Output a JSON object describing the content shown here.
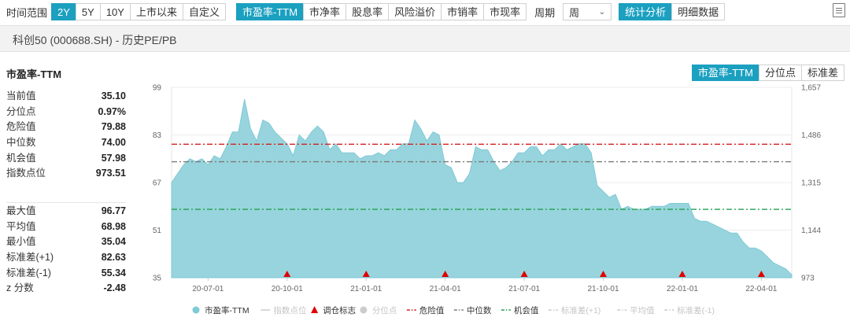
{
  "toolbar": {
    "time_label": "时间范围",
    "ranges": [
      {
        "label": "2Y",
        "active": true
      },
      {
        "label": "5Y",
        "active": false
      },
      {
        "label": "10Y",
        "active": false
      },
      {
        "label": "上市以来",
        "active": false
      },
      {
        "label": "自定义",
        "active": false
      }
    ],
    "metrics": [
      {
        "label": "市盈率-TTM",
        "active": true
      },
      {
        "label": "市净率",
        "active": false
      },
      {
        "label": "股息率",
        "active": false
      },
      {
        "label": "风险溢价",
        "active": false
      },
      {
        "label": "市销率",
        "active": false
      },
      {
        "label": "市现率",
        "active": false
      }
    ],
    "period_label": "周期",
    "period_value": "周",
    "views": [
      {
        "label": "统计分析",
        "active": true
      },
      {
        "label": "明细数据",
        "active": false
      }
    ]
  },
  "page_title": "科创50 (000688.SH) - 历史PE/PB",
  "panel_title": "市盈率-TTM",
  "stats_top": [
    {
      "label": "当前值",
      "value": "35.10"
    },
    {
      "label": "分位点",
      "value": "0.97%"
    },
    {
      "label": "危险值",
      "value": "79.88"
    },
    {
      "label": "中位数",
      "value": "74.00"
    },
    {
      "label": "机会值",
      "value": "57.98"
    },
    {
      "label": "指数点位",
      "value": "973.51"
    }
  ],
  "stats_bottom": [
    {
      "label": "最大值",
      "value": "96.77"
    },
    {
      "label": "平均值",
      "value": "68.98"
    },
    {
      "label": "最小值",
      "value": "35.04"
    },
    {
      "label": "标准差(+1)",
      "value": "82.63"
    },
    {
      "label": "标准差(-1)",
      "value": "55.34"
    },
    {
      "label": "z 分数",
      "value": "-2.48"
    }
  ],
  "right_tabs": [
    {
      "label": "市盈率-TTM",
      "active": true
    },
    {
      "label": "分位点",
      "active": false
    },
    {
      "label": "标准差",
      "active": false
    }
  ],
  "chart_data": {
    "type": "area",
    "y_left_ticks": [
      "99",
      "83",
      "67",
      "51",
      "35"
    ],
    "y_left_range": [
      35,
      99
    ],
    "y_right_ticks": [
      "1,657",
      "1,486",
      "1,315",
      "1,144",
      "973"
    ],
    "x_ticks": [
      "20-07-01",
      "20-10-01",
      "21-01-01",
      "21-04-01",
      "21-07-01",
      "21-10-01",
      "22-01-01",
      "22-04-01"
    ],
    "x_tick_weeks": [
      6,
      19,
      32,
      45,
      58,
      71,
      84,
      97
    ],
    "series": [
      {
        "name": "市盈率-TTM",
        "color": "#7ecad6",
        "values": [
          67,
          70,
          73,
          75,
          74,
          75,
          73,
          76,
          75,
          79,
          84,
          84,
          95,
          85,
          81,
          88,
          87,
          84,
          82,
          80,
          76,
          83,
          81,
          84,
          86,
          84,
          78,
          80,
          77,
          77,
          77,
          75,
          76,
          76,
          77,
          76,
          78,
          78,
          80,
          80,
          88,
          85,
          81,
          84,
          83,
          73,
          72,
          67,
          67,
          70,
          79,
          78,
          78,
          74,
          71,
          72,
          74,
          77,
          77,
          79,
          79,
          76,
          78,
          78,
          80,
          78,
          79,
          80,
          80,
          77,
          66,
          64,
          62,
          63,
          58,
          59,
          58,
          58,
          58,
          59,
          59,
          59,
          60,
          60,
          60,
          60,
          55,
          54,
          54,
          53,
          52,
          51,
          50,
          50,
          47,
          45,
          45,
          44,
          42,
          40,
          39,
          38,
          36
        ]
      }
    ],
    "reference_lines": [
      {
        "name": "危险值",
        "value": 79.88,
        "color": "#d42020"
      },
      {
        "name": "中位数",
        "value": 74.0,
        "color": "#7a7a7a"
      },
      {
        "name": "机会值",
        "value": 57.98,
        "color": "#20a050"
      }
    ],
    "rebalance_weeks": [
      19,
      32,
      45,
      58,
      71,
      84,
      97
    ],
    "legend": [
      {
        "label": "市盈率-TTM",
        "marker": "dot",
        "color": "#7ecad6",
        "active": true
      },
      {
        "label": "指数点位",
        "marker": "line",
        "color": "#cccccc",
        "active": false
      },
      {
        "label": "调仓标志",
        "marker": "triangle",
        "color": "#e00000",
        "active": true
      },
      {
        "label": "分位点",
        "marker": "dot",
        "color": "#cccccc",
        "active": false
      },
      {
        "label": "危险值",
        "marker": "dashdot",
        "color": "#d42020",
        "active": true
      },
      {
        "label": "中位数",
        "marker": "dashdot",
        "color": "#7a7a7a",
        "active": true
      },
      {
        "label": "机会值",
        "marker": "dashdot",
        "color": "#20a050",
        "active": true
      },
      {
        "label": "标准差(+1)",
        "marker": "dashdot",
        "color": "#cccccc",
        "active": false
      },
      {
        "label": "平均值",
        "marker": "dashdot",
        "color": "#cccccc",
        "active": false
      },
      {
        "label": "标准差(-1)",
        "marker": "dashdot",
        "color": "#cccccc",
        "active": false
      }
    ],
    "legend_position": "bottom"
  }
}
